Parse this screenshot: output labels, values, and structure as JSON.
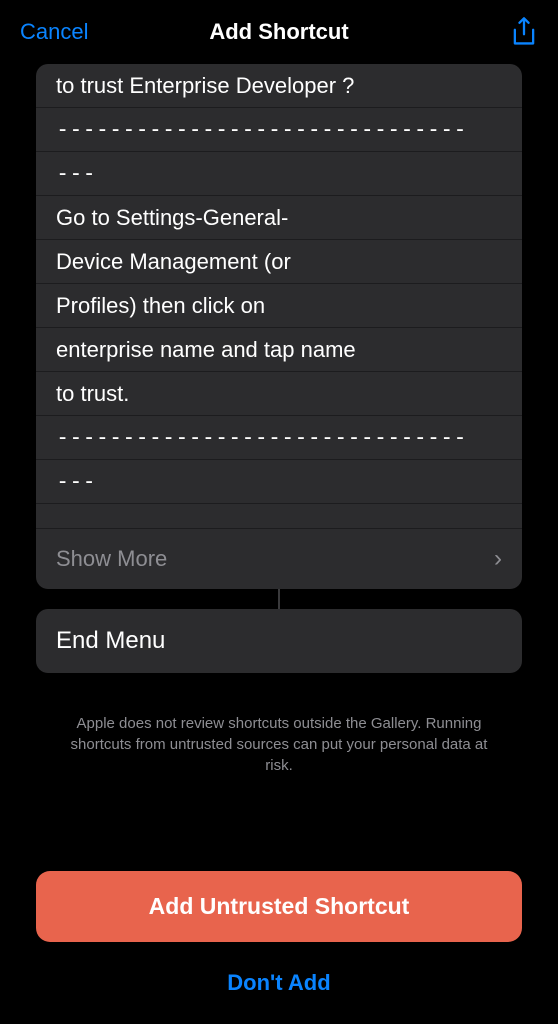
{
  "header": {
    "cancel": "Cancel",
    "title": "Add Shortcut"
  },
  "content": {
    "lines": {
      "line1": "to trust Enterprise Developer ?",
      "line2": "-------------------------------",
      "line3": "---",
      "line4": "Go to Settings-General-",
      "line5": "Device Management (or",
      "line6": "Profiles) then click on",
      "line7": "enterprise name and tap name",
      "line8": "to trust.",
      "line9": "-------------------------------",
      "line10": "---"
    },
    "showMore": "Show More",
    "endMenu": "End Menu"
  },
  "warning": "Apple does not review shortcuts outside the Gallery. Running shortcuts from untrusted sources can put your personal data at risk.",
  "actions": {
    "add": "Add Untrusted Shortcut",
    "dontAdd": "Don't Add"
  }
}
